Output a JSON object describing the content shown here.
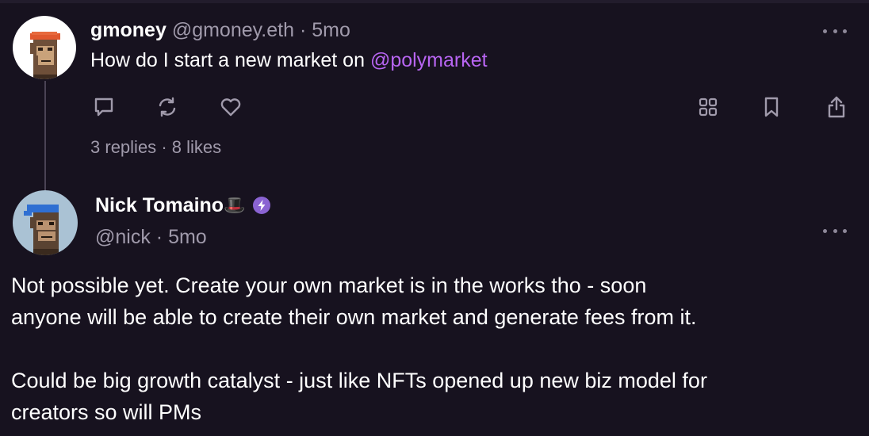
{
  "post1": {
    "author_name": "gmoney",
    "author_handle": "@gmoney.eth",
    "separator": "·",
    "age": "5mo",
    "text_prefix": "How do I start a new market on ",
    "mention": "@polymarket",
    "replies_count": "3",
    "replies_label": "replies",
    "likes_count": "8",
    "likes_label": "likes",
    "dot": "·"
  },
  "post2": {
    "author_name": "Nick Tomaino",
    "author_emoji": "🎩",
    "author_handle": "@nick",
    "separator": "·",
    "age": "5mo",
    "line1": "Not possible yet. Create your own market is in the works tho - soon",
    "line2": "anyone will be able to create their own market and generate fees from it.",
    "line3": "Could be big growth catalyst - just like NFTs opened up new biz model for",
    "line4": "creators so will PMs"
  },
  "icons": {
    "reply": "reply-icon",
    "recast": "recast-icon",
    "like": "heart-icon",
    "grid": "grid-icon",
    "bookmark": "bookmark-icon",
    "share": "share-icon",
    "more": "more-dots-icon",
    "power_badge": "power-badge-icon"
  },
  "colors": {
    "background": "#17121f",
    "mention": "#b865f2",
    "muted": "#a09aab",
    "badge": "#8a63d2"
  }
}
